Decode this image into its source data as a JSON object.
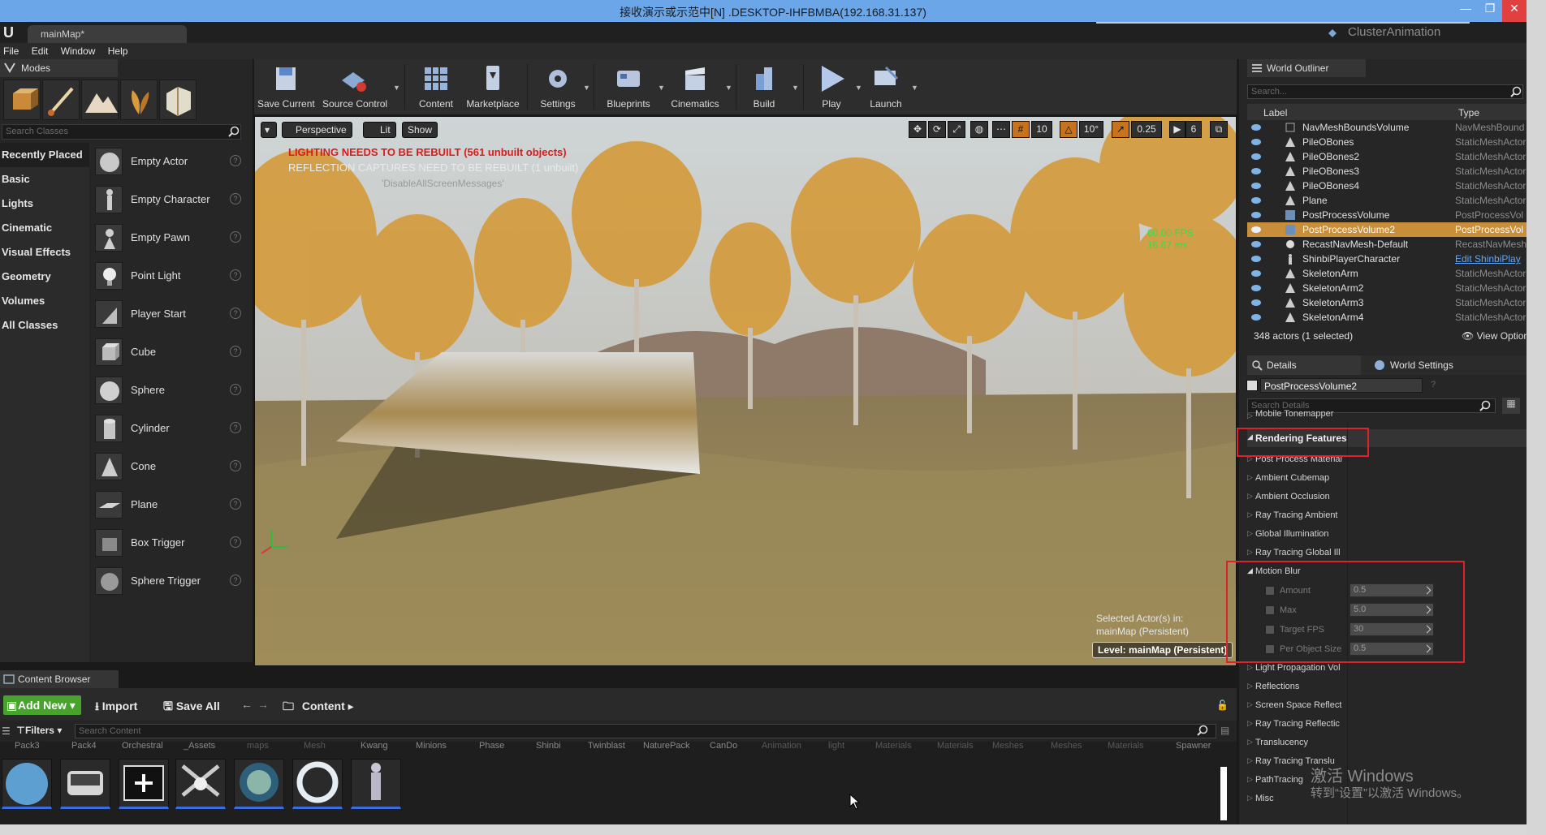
{
  "remote": {
    "title": "接收演示或示范中[N] .DESKTOP-IHFBMBA(192.168.31.137)",
    "minimize_glyph": "—",
    "restore_glyph": "❐"
  },
  "app": {
    "map_tab": "mainMap*",
    "project": "ClusterAnimation",
    "menu": [
      "File",
      "Edit",
      "Window",
      "Help"
    ]
  },
  "modes": {
    "header": "Modes",
    "search_placeholder": "Search Classes",
    "categories": [
      "Recently Placed",
      "Basic",
      "Lights",
      "Cinematic",
      "Visual Effects",
      "Geometry",
      "Volumes",
      "All Classes"
    ],
    "items": [
      "Empty Actor",
      "Empty Character",
      "Empty Pawn",
      "Point Light",
      "Player Start",
      "Cube",
      "Sphere",
      "Cylinder",
      "Cone",
      "Plane",
      "Box Trigger",
      "Sphere Trigger"
    ]
  },
  "toolbar": {
    "save_current": "Save Current",
    "source_control": "Source Control",
    "content": "Content",
    "marketplace": "Marketplace",
    "settings": "Settings",
    "blueprints": "Blueprints",
    "cinematics": "Cinematics",
    "build": "Build",
    "play": "Play",
    "launch": "Launch"
  },
  "viewport": {
    "perspective": "Perspective",
    "lit": "Lit",
    "show": "Show",
    "grid_snap": "10",
    "rot_snap": "10°",
    "scale_snap": "0.25",
    "cam_speed": "6",
    "warning_lighting": "LIGHTING NEEDS TO BE REBUILT (561 unbuilt objects)",
    "warning_reflection": "REFLECTION CAPTURES NEED TO BE REBUILT (1 unbuilt)",
    "screen_messages": "'DisableAllScreenMessages'",
    "fps": "60.00 FPS",
    "ms": "16.67 ms",
    "selected_actor_line1": "Selected Actor(s) in:",
    "selected_actor_line2": "mainMap (Persistent)",
    "level": "Level:  mainMap (Persistent)"
  },
  "content_browser": {
    "tab": "Content Browser",
    "add_new": "Add New",
    "import": "Import",
    "save_all": "Save All",
    "path": "Content",
    "filters": "Filters",
    "search_placeholder": "Search Content",
    "folders": [
      "Pack3",
      "Pack4",
      "Orchestral",
      "_Assets",
      "maps",
      "Mesh",
      "Kwang",
      "Minions",
      "Phase",
      "Shinbi",
      "Twinblast",
      "NaturePack",
      "CanDo",
      "Animation",
      "light",
      "Materials",
      "Materials",
      "Meshes",
      "Meshes",
      "Materials",
      "Spawner"
    ]
  },
  "world_outliner": {
    "tab": "World Outliner",
    "search_placeholder": "Search...",
    "col_label": "Label",
    "col_type": "Type",
    "rows": [
      {
        "label": "NavMeshBoundsVolume",
        "type": "NavMeshBound"
      },
      {
        "label": "PileOBones",
        "type": "StaticMeshActor"
      },
      {
        "label": "PileOBones2",
        "type": "StaticMeshActor"
      },
      {
        "label": "PileOBones3",
        "type": "StaticMeshActor"
      },
      {
        "label": "PileOBones4",
        "type": "StaticMeshActor"
      },
      {
        "label": "Plane",
        "type": "StaticMeshActor"
      },
      {
        "label": "PostProcessVolume",
        "type": "PostProcessVol"
      },
      {
        "label": "PostProcessVolume2",
        "type": "PostProcessVol"
      },
      {
        "label": "RecastNavMesh-Default",
        "type": "RecastNavMesh"
      },
      {
        "label": "ShinbiPlayerCharacter",
        "type": "Edit ShinbiPlay"
      },
      {
        "label": "SkeletonArm",
        "type": "StaticMeshActor"
      },
      {
        "label": "SkeletonArm2",
        "type": "StaticMeshActor"
      },
      {
        "label": "SkeletonArm3",
        "type": "StaticMeshActor"
      },
      {
        "label": "SkeletonArm4",
        "type": "StaticMeshActor"
      }
    ],
    "actor_count": "348 actors (1 selected)",
    "view_options": "View Options"
  },
  "details": {
    "tab": "Details",
    "world_settings_tab": "World Settings",
    "actor_name": "PostProcessVolume2",
    "search_placeholder": "Search Details",
    "mobile_tonemapper": "Mobile Tonemapper",
    "rendering_features": "Rendering Features",
    "sections_a": [
      "Post Process Material",
      "Ambient Cubemap",
      "Ambient Occlusion",
      "Ray Tracing Ambient",
      "Global Illumination",
      "Ray Tracing Global Ill"
    ],
    "motion_blur": "Motion Blur",
    "motion_props": [
      {
        "name": "Amount",
        "value": "0.5"
      },
      {
        "name": "Max",
        "value": "5.0"
      },
      {
        "name": "Target FPS",
        "value": "30"
      },
      {
        "name": "Per Object Size",
        "value": "0.5"
      }
    ],
    "sections_b": [
      "Light Propagation Vol",
      "Reflections",
      "Screen Space Reflect",
      "Ray Tracing Reflectic",
      "Translucency",
      "Ray Tracing Translu",
      "PathTracing",
      "Misc"
    ]
  },
  "watermark": {
    "line1": "激活 Windows",
    "line2": "转到“设置”以激活 Windows。"
  },
  "colors": {
    "accent_select": "#c88e3a",
    "add_new": "#49a22e",
    "highlight_box": "#e0202a"
  }
}
